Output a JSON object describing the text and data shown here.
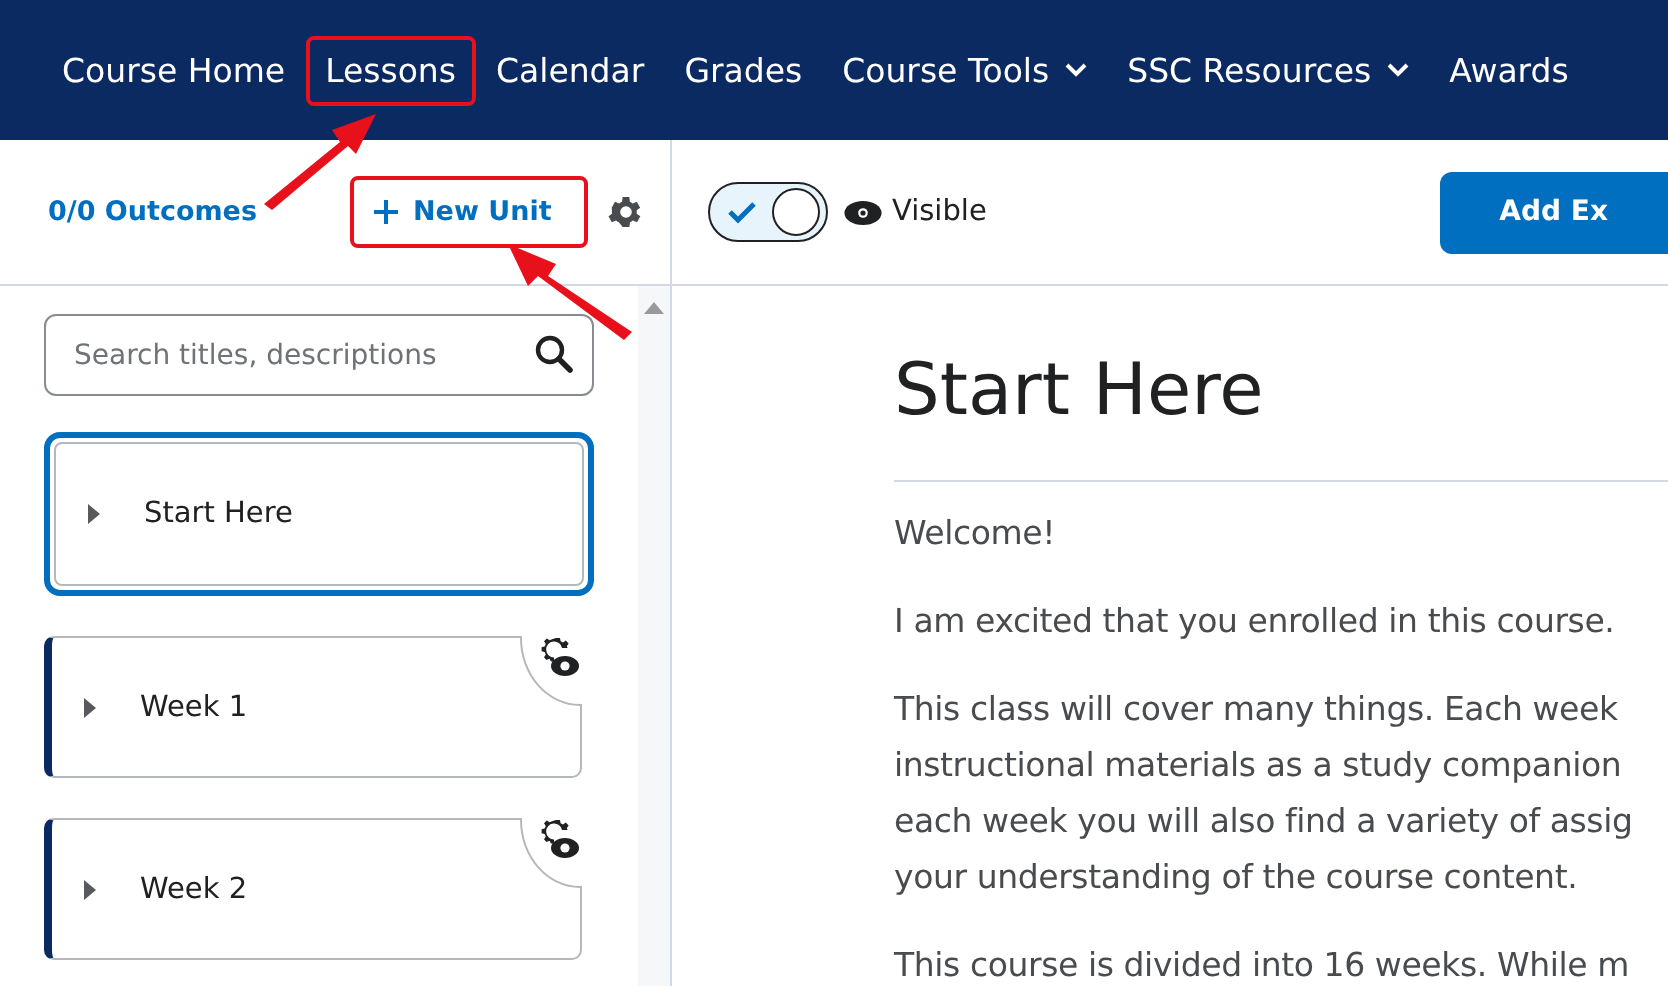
{
  "nav": [
    {
      "label": "Course Home",
      "dropdown": false,
      "highlighted": false
    },
    {
      "label": "Lessons",
      "dropdown": false,
      "highlighted": true
    },
    {
      "label": "Calendar",
      "dropdown": false,
      "highlighted": false
    },
    {
      "label": "Grades",
      "dropdown": false,
      "highlighted": false
    },
    {
      "label": "Course Tools",
      "dropdown": true,
      "highlighted": false
    },
    {
      "label": "SSC Resources",
      "dropdown": true,
      "highlighted": false
    },
    {
      "label": "Awards",
      "dropdown": false,
      "highlighted": false
    }
  ],
  "sidebar": {
    "outcomes": "0/0 Outcomes",
    "new_unit": {
      "label": "New Unit",
      "highlighted": true
    },
    "search": {
      "placeholder": "Search titles, descriptions"
    },
    "units": [
      {
        "title": "Start Here",
        "selected": true,
        "expanded": false,
        "status_icon": false
      },
      {
        "title": "Week 1",
        "selected": false,
        "expanded": false,
        "status_icon": true
      },
      {
        "title": "Week 2",
        "selected": false,
        "expanded": false,
        "status_icon": true
      }
    ]
  },
  "content": {
    "visibility": {
      "label": "Visible",
      "on": true
    },
    "add_button": "Add Ex",
    "title": "Start Here",
    "paragraphs": [
      [
        "Welcome!"
      ],
      [
        "I am excited that you enrolled in this course."
      ],
      [
        "This class will cover many things. Each week",
        "instructional materials as a study companion",
        "each week you will also find a variety of assig",
        "your understanding of the course content."
      ],
      [
        "This course is divided into 16 weeks. While m"
      ]
    ]
  }
}
